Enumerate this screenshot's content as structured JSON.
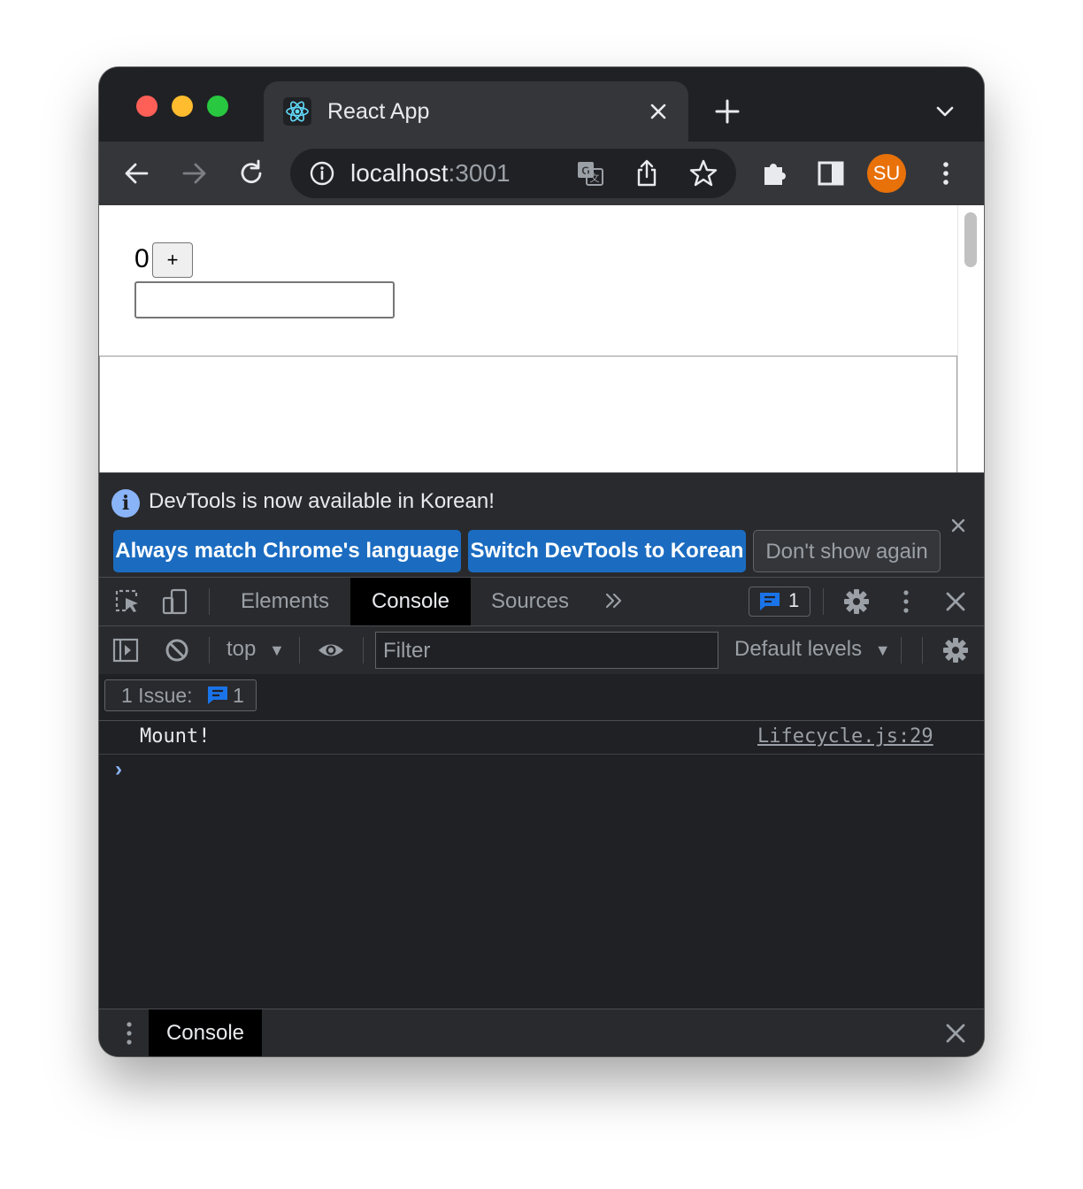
{
  "browser": {
    "tab": {
      "title": "React App",
      "favicon": "react-icon"
    },
    "address": {
      "host": "localhost",
      "port": ":3001"
    },
    "profile": {
      "initials": "SU",
      "color": "#e8710a"
    }
  },
  "page": {
    "counter_value": "0",
    "plus_label": "+",
    "input_value": ""
  },
  "devtools": {
    "infobar": {
      "message": "DevTools is now available in Korean!",
      "buttons": {
        "match_language": "Always match Chrome's language",
        "switch_korean": "Switch DevTools to Korean",
        "dont_show": "Don't show again"
      }
    },
    "tabs": {
      "elements": "Elements",
      "console": "Console",
      "sources": "Sources",
      "issues_count": "1"
    },
    "console_toolbar": {
      "context": "top",
      "filter_placeholder": "Filter",
      "levels": "Default levels"
    },
    "issues_bar": {
      "label": "1 Issue:",
      "count": "1"
    },
    "log": [
      {
        "message": "Mount!",
        "source": "Lifecycle.js:29"
      }
    ],
    "prompt": "›",
    "drawer": {
      "tab": "Console"
    }
  }
}
